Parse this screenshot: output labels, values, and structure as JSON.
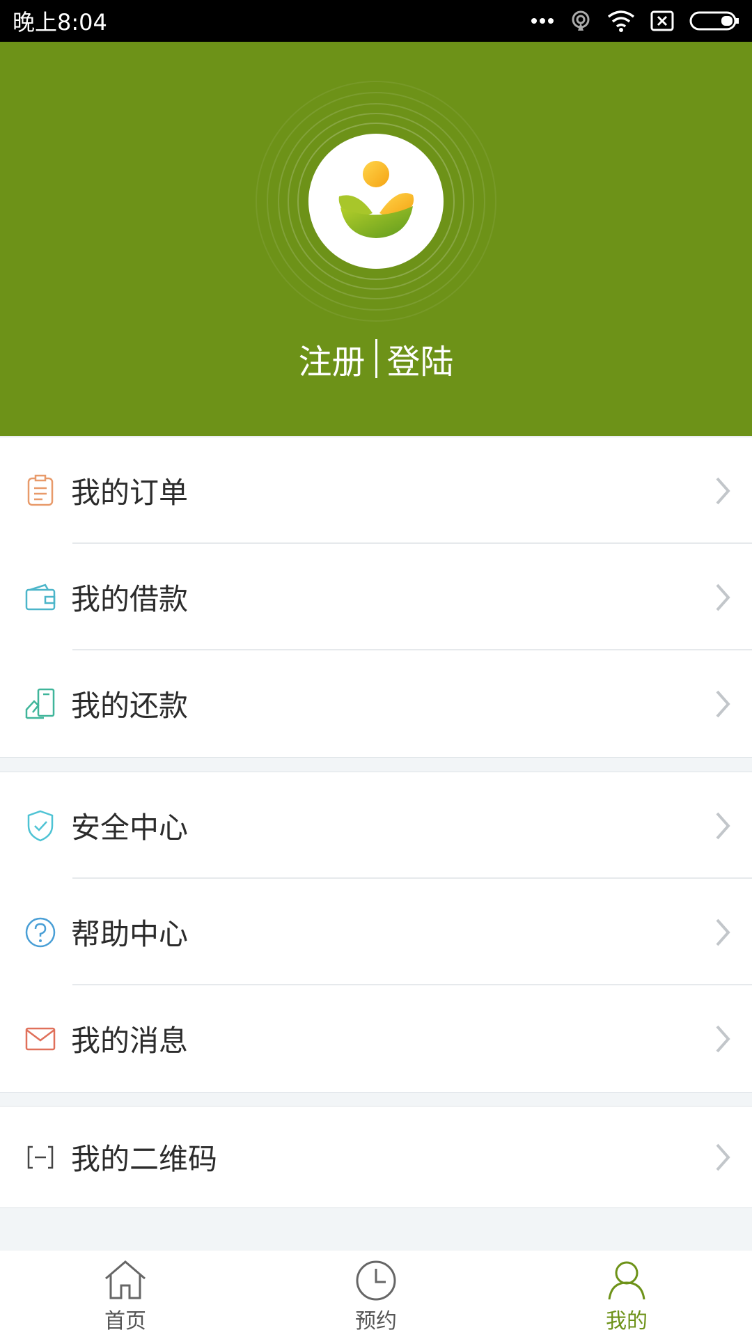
{
  "status_bar": {
    "time": "晚上8:04",
    "icons": [
      "more-dots-icon",
      "hotspot-icon",
      "wifi-icon",
      "sim-x-icon",
      "battery-icon"
    ]
  },
  "header": {
    "register_label": "注册",
    "login_label": "登陆",
    "background_color": "#6d9218"
  },
  "menu_groups": [
    {
      "items": [
        {
          "label": "我的订单",
          "icon": "order-icon"
        },
        {
          "label": "我的借款",
          "icon": "wallet-icon"
        },
        {
          "label": "我的还款",
          "icon": "repayment-icon"
        }
      ]
    },
    {
      "items": [
        {
          "label": "安全中心",
          "icon": "shield-icon"
        },
        {
          "label": "帮助中心",
          "icon": "help-icon"
        },
        {
          "label": "我的消息",
          "icon": "mail-icon"
        }
      ]
    },
    {
      "items": [
        {
          "label": "我的二维码",
          "icon": "qr-code-icon"
        }
      ]
    }
  ],
  "tabbar": {
    "tabs": [
      {
        "label": "首页",
        "icon": "home-icon",
        "active": false
      },
      {
        "label": "预约",
        "icon": "clock-icon",
        "active": false
      },
      {
        "label": "我的",
        "icon": "user-icon",
        "active": true
      }
    ],
    "active_color": "#6d9218"
  }
}
